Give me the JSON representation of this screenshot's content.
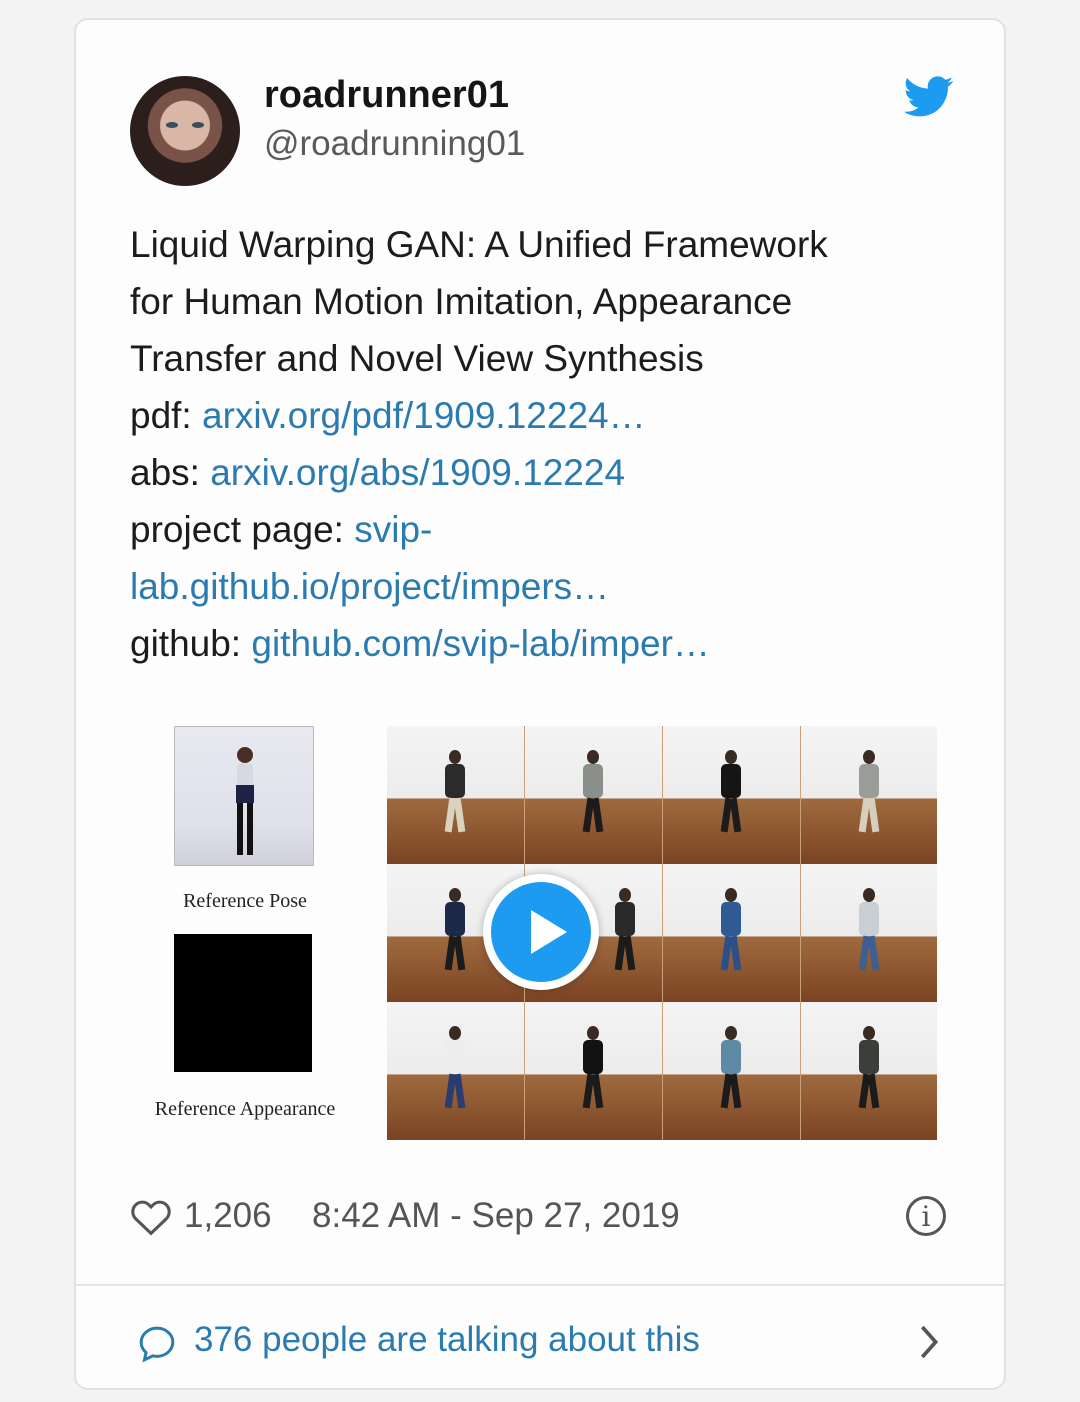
{
  "tweet": {
    "author_name": "roadrunner01",
    "author_handle": "@roadrunning01",
    "text_lines": [
      "Liquid Warping GAN: A Unified Framework",
      "for Human Motion Imitation, Appearance",
      "Transfer and Novel View Synthesis"
    ],
    "links": {
      "pdf_label": "pdf: ",
      "pdf_url": "arxiv.org/pdf/1909.12224…",
      "abs_label": "abs: ",
      "abs_url": "arxiv.org/abs/1909.12224",
      "project_label": "project page: ",
      "project_url_1": "svip-",
      "project_url_2": "lab.github.io/project/impers…",
      "github_label": "github: ",
      "github_url": "github.com/svip-lab/imper…"
    },
    "media": {
      "ref_pose_label": "Reference Pose",
      "ref_appearance_label": "Reference Appearance",
      "play_icon": "play-icon"
    },
    "likes": "1,206",
    "timestamp": "8:42 AM - Sep 27, 2019",
    "talking": "376 people are talking about this"
  },
  "colors": {
    "link": "#2b7bb0",
    "twitter_blue": "#1d9bf0"
  },
  "icons": [
    "twitter-bird-icon",
    "heart-icon",
    "info-icon",
    "comment-bubble-icon",
    "chevron-right-icon"
  ]
}
